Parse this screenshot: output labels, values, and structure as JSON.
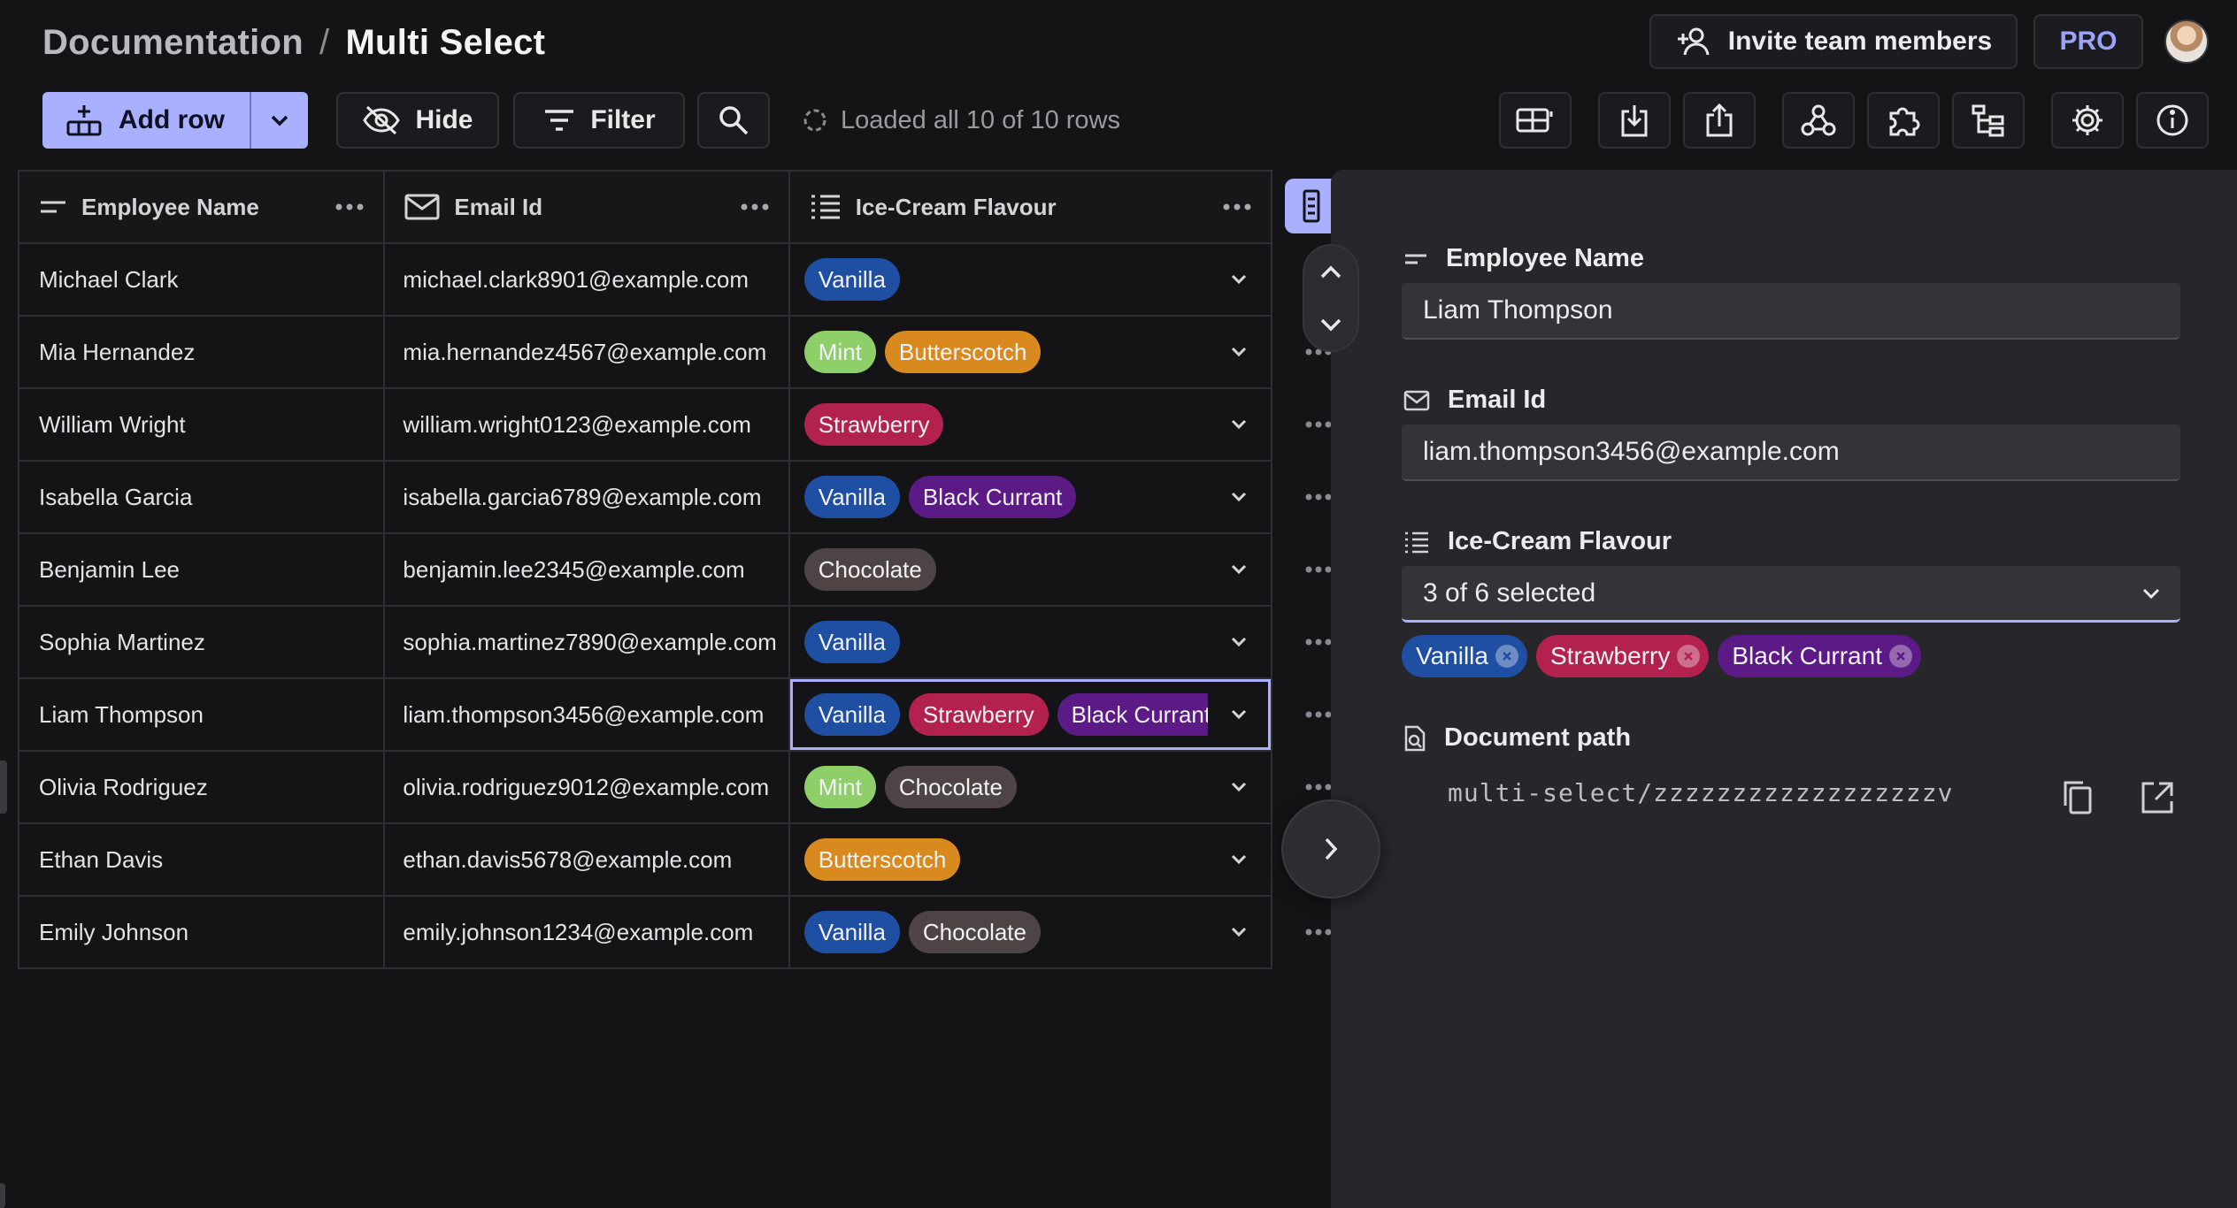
{
  "breadcrumb": {
    "parent": "Documentation",
    "separator": "/",
    "current": "Multi Select"
  },
  "header": {
    "invite_label": "Invite team members",
    "pro_label": "PRO"
  },
  "toolbar": {
    "add_row_label": "Add row",
    "hide_label": "Hide",
    "filter_label": "Filter",
    "status_text": "Loaded all 10 of 10 rows"
  },
  "table": {
    "columns": [
      {
        "label": "Employee Name",
        "icon": "text-field-icon"
      },
      {
        "label": "Email Id",
        "icon": "mail-icon"
      },
      {
        "label": "Ice-Cream Flavour",
        "icon": "list-icon"
      }
    ],
    "rows": [
      {
        "name": "Michael Clark",
        "email": "michael.clark8901@example.com",
        "flavours": [
          "Vanilla"
        ]
      },
      {
        "name": "Mia Hernandez",
        "email": "mia.hernandez4567@example.com",
        "flavours": [
          "Mint",
          "Butterscotch"
        ]
      },
      {
        "name": "William Wright",
        "email": "william.wright0123@example.com",
        "flavours": [
          "Strawberry"
        ]
      },
      {
        "name": "Isabella Garcia",
        "email": "isabella.garcia6789@example.com",
        "flavours": [
          "Vanilla",
          "Black Currant"
        ]
      },
      {
        "name": "Benjamin Lee",
        "email": "benjamin.lee2345@example.com",
        "flavours": [
          "Chocolate"
        ]
      },
      {
        "name": "Sophia Martinez",
        "email": "sophia.martinez7890@example.com",
        "flavours": [
          "Vanilla"
        ]
      },
      {
        "name": "Liam Thompson",
        "email": "liam.thompson3456@example.com",
        "flavours": [
          "Vanilla",
          "Strawberry",
          "Black Currant"
        ]
      },
      {
        "name": "Olivia Rodriguez",
        "email": "olivia.rodriguez9012@example.com",
        "flavours": [
          "Mint",
          "Chocolate"
        ]
      },
      {
        "name": "Ethan Davis",
        "email": "ethan.davis5678@example.com",
        "flavours": [
          "Butterscotch"
        ]
      },
      {
        "name": "Emily Johnson",
        "email": "emily.johnson1234@example.com",
        "flavours": [
          "Vanilla",
          "Chocolate"
        ]
      }
    ],
    "active_row": 6
  },
  "flavour_colors": {
    "Vanilla": "#1f4fa3",
    "Mint": "#8fcf6a",
    "Butterscotch": "#d98a1e",
    "Strawberry": "#b3214f",
    "Black Currant": "#5b1a86",
    "Chocolate": "#4e4446"
  },
  "panel": {
    "name_label": "Employee Name",
    "name_value": "Liam Thompson",
    "email_label": "Email Id",
    "email_value": "liam.thompson3456@example.com",
    "flavour_label": "Ice-Cream Flavour",
    "flavour_summary": "3 of 6 selected",
    "selected_flavours": [
      "Vanilla",
      "Strawberry",
      "Black Currant"
    ],
    "doc_path_label": "Document path",
    "doc_path_value": "multi-select/zzzzzzzzzzzzzzzzzzv"
  },
  "theme": {
    "accent": "#a9b0ff",
    "background": "#141417",
    "panel": "#27272b"
  }
}
